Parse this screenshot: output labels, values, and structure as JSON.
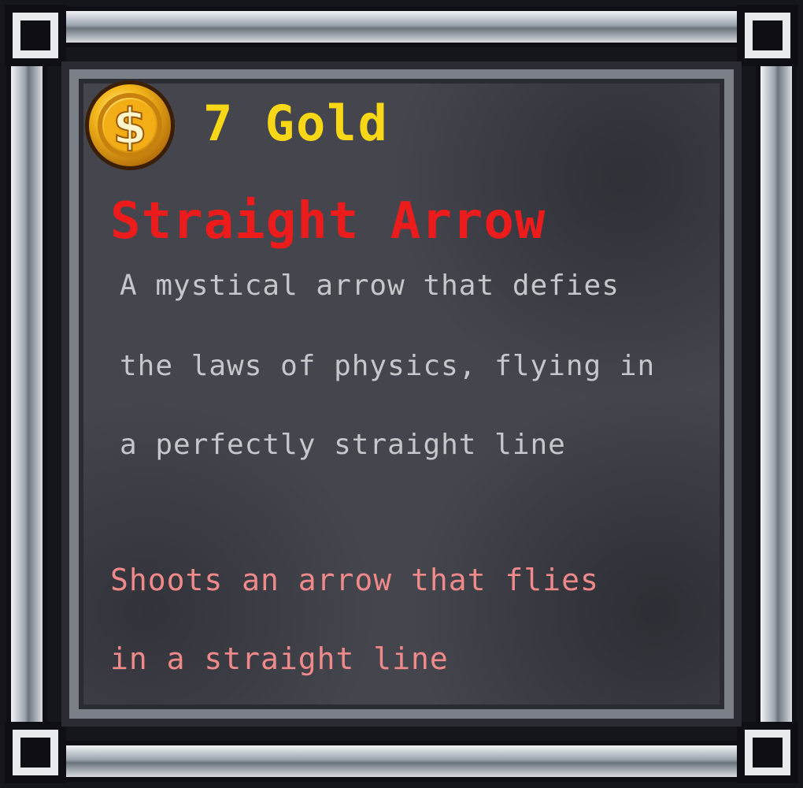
{
  "price": {
    "icon": "gold-coin-icon",
    "text": "7 Gold",
    "color": "#f7d716"
  },
  "item": {
    "name": "Straight Arrow",
    "name_color": "#ec1c1c"
  },
  "description": {
    "lines": [
      "A mystical arrow that defies",
      "the laws of physics, flying in",
      "a perfectly straight line"
    ],
    "color": "#c6c7cb"
  },
  "effect": {
    "lines": [
      "Shoots an arrow that flies",
      "in a straight line"
    ],
    "color": "#f08a8a"
  }
}
